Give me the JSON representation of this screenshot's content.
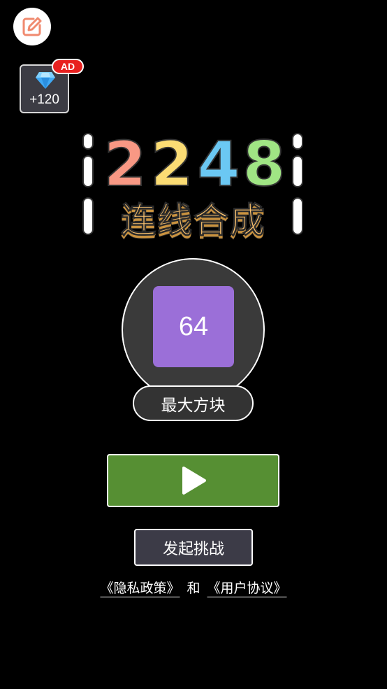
{
  "header": {
    "feedback_icon": "edit-icon",
    "ad_reward": {
      "badge": "AD",
      "amount": "+120",
      "icon": "diamond-icon",
      "gem_color": "#3fa9f5"
    }
  },
  "logo": {
    "digits": [
      "2",
      "2",
      "4",
      "8"
    ],
    "digit_colors": [
      "#f89884",
      "#fbdc74",
      "#6bc8f3",
      "#a0e584"
    ],
    "title": "连线合成",
    "title_color": "#fcc36f"
  },
  "max_block": {
    "value": "64",
    "label": "最大方块",
    "tile_color": "#9b6fd8"
  },
  "actions": {
    "play_icon": "play-icon",
    "play_color": "#568f33",
    "challenge_label": "发起挑战"
  },
  "legal": {
    "privacy": "《隐私政策》",
    "and": "和",
    "terms": "《用户协议》"
  }
}
